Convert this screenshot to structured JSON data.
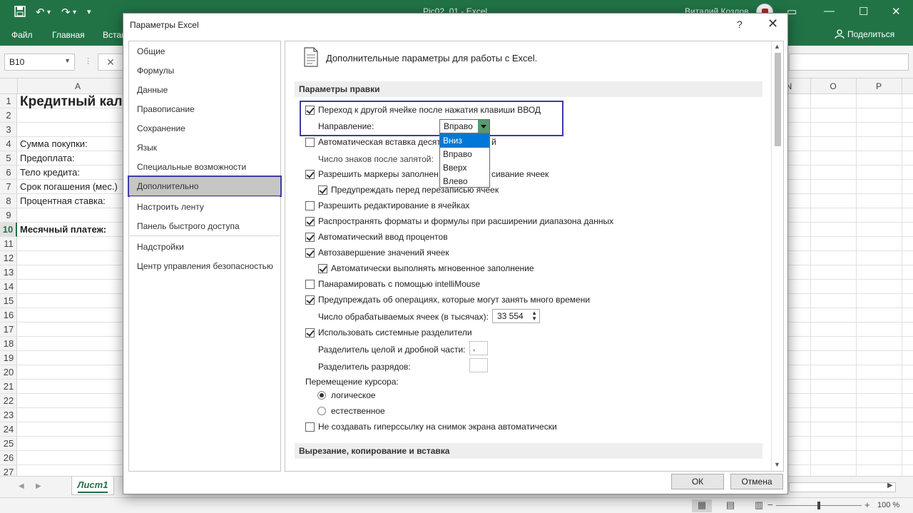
{
  "excel": {
    "doc_title": "Pic02_01 - Excel",
    "user_name": "Виталий Козлов",
    "ribbon_tabs": [
      "Файл",
      "Главная",
      "Вставка"
    ],
    "share_label": "Поделиться",
    "name_box": "B10",
    "columns": [
      "A",
      "N",
      "O",
      "P"
    ],
    "rows": [
      "1",
      "2",
      "3",
      "4",
      "5",
      "6",
      "7",
      "8",
      "9",
      "10",
      "11",
      "12",
      "13",
      "14",
      "15",
      "16",
      "17",
      "18",
      "19",
      "20",
      "21",
      "22",
      "23",
      "24",
      "25",
      "26",
      "27"
    ],
    "selected_row": "10",
    "cells": {
      "title": "Кредитный кал",
      "r4": "Сумма покупки:",
      "r5": "Предоплата:",
      "r6": "Тело кредита:",
      "r7": "Срок погашения (мес.)",
      "r8": "Процентная ставка:",
      "r10": "Месячный платеж:"
    },
    "sheet_tab": "Лист1",
    "zoom": "100 %"
  },
  "dialog": {
    "title": "Параметры Excel",
    "help": "?",
    "close": "✕",
    "nav": [
      "Общие",
      "Формулы",
      "Данные",
      "Правописание",
      "Сохранение",
      "Язык",
      "Специальные возможности",
      "Дополнительно",
      "Настроить ленту",
      "Панель быстрого доступа",
      "Надстройки",
      "Центр управления безопасностью"
    ],
    "active_nav": "Дополнительно",
    "header": "Дополнительные параметры для работы с Excel.",
    "section_edit": "Параметры правки",
    "section_cut": "Вырезание, копирование и вставка",
    "options": {
      "move_after_enter": "Переход к другой ячейке после нажатия клавиши ВВОД",
      "direction_label": "Направление:",
      "direction_value": "Вправо",
      "direction_options": [
        "Вниз",
        "Вправо",
        "Вверх",
        "Влево"
      ],
      "direction_highlighted": "Вниз",
      "auto_decimal": "Автоматическая вставка десяти",
      "auto_decimal_tail": "й",
      "decimals_label": "Число знаков после запятой:",
      "fill_handle": "Разрешить маркеры заполнен",
      "fill_handle_tail": "сивание ячеек",
      "warn_overwrite": "Предупреждать перед перезаписью ячеек",
      "edit_in_cells": "Разрешить редактирование в ячейках",
      "extend_formats": "Распространять форматы и формулы при расширении диапазона данных",
      "auto_percent": "Автоматический ввод процентов",
      "autocomplete": "Автозавершение значений ячеек",
      "flash_fill": "Автоматически выполнять мгновенное заполнение",
      "intellimouse": "Панарамировать с помощью intelliMouse",
      "warn_long_ops": "Предупреждать об операциях, которые могут занять много времени",
      "cells_count_label": "Число обрабатываемых ячеек (в тысячах):",
      "cells_count_value": "33 554",
      "system_separators": "Использовать системные разделители",
      "decimal_sep_label": "Разделитель целой и дробной части:",
      "decimal_sep_value": ",",
      "thousands_sep_label": "Разделитель разрядов:",
      "cursor_move_label": "Перемещение курсора:",
      "cursor_logical": "логическое",
      "cursor_visual": "естественное",
      "no_hyperlink": "Не создавать гиперссылку на снимок экрана автоматически"
    },
    "ok_label": "ОК",
    "cancel_label": "Отмена"
  }
}
